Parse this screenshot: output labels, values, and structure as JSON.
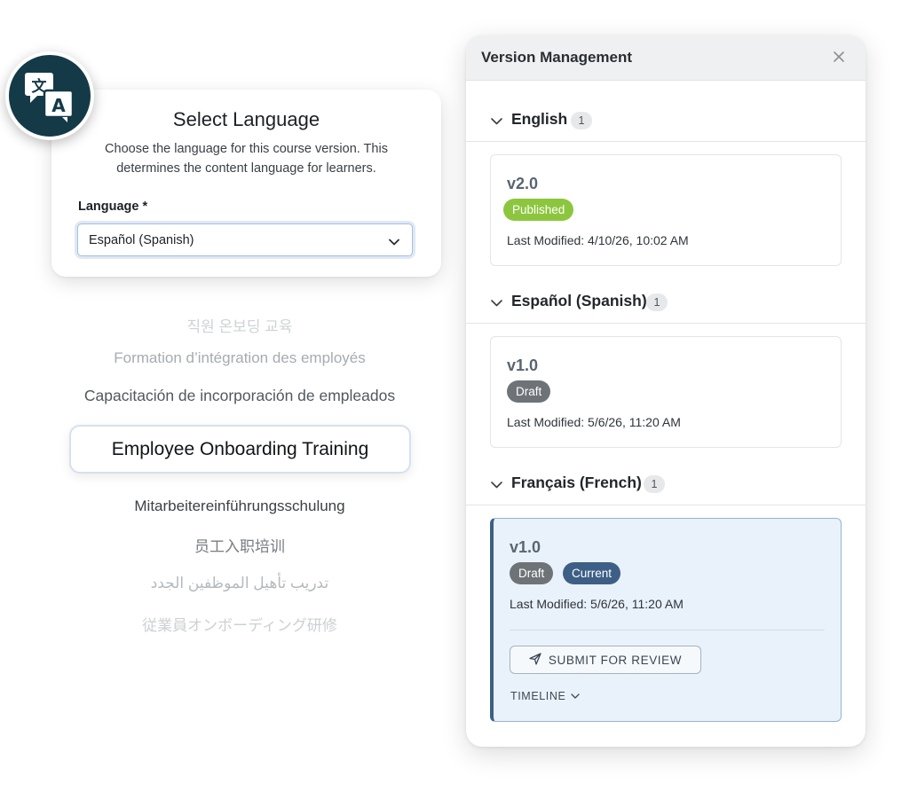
{
  "select_language": {
    "title": "Select Language",
    "description": "Choose the language for this course version. This determines the content language for learners.",
    "field_label": "Language *",
    "selected_value": "Español (Spanish)"
  },
  "translations": {
    "korean": "직원 온보딩 교육",
    "french": "Formation d’intégration des employés",
    "spanish": "Capacitación de incorporación de empleados",
    "english": "Employee Onboarding Training",
    "german": "Mitarbeitereinführungsschulung",
    "chinese": "员工入职培训",
    "arabic": "تدريب تأهيل الموظفين الجدد",
    "japanese": "従業員オンボーディング研修"
  },
  "version_management": {
    "title": "Version Management",
    "groups": [
      {
        "name": "English",
        "count": "1",
        "version": "v2.0",
        "badges": [
          "Published"
        ],
        "last_modified": "Last Modified: 4/10/26, 10:02 AM"
      },
      {
        "name": "Español (Spanish)",
        "count": "1",
        "version": "v1.0",
        "badges": [
          "Draft"
        ],
        "last_modified": "Last Modified: 5/6/26, 11:20 AM"
      },
      {
        "name": "Français (French)",
        "count": "1",
        "version": "v1.0",
        "badges": [
          "Draft",
          "Current"
        ],
        "last_modified": "Last Modified: 5/6/26, 11:20 AM",
        "action_label": "SUBMIT FOR REVIEW",
        "timeline_label": "TIMELINE"
      }
    ]
  },
  "colors": {
    "badge_background": "#143a48",
    "published": "#8cc63e",
    "draft": "#6e7378",
    "current": "#3d5f86",
    "current_card_bg": "#e9f1fb"
  },
  "icons": {
    "language": "translate-icon",
    "select": "chevron-down-icon",
    "close": "close-icon",
    "collapse": "chevron-down-icon",
    "submit": "paper-plane-icon"
  }
}
